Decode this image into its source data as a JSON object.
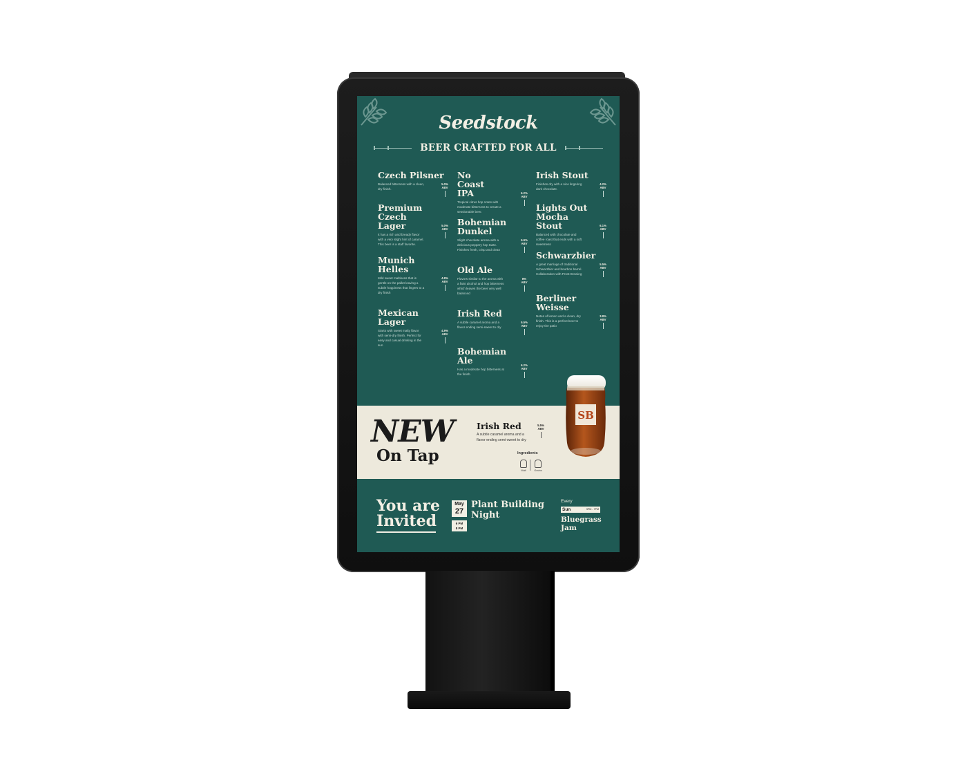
{
  "brand": "Seedstock",
  "tagline": "BEER CRAFTED FOR ALL",
  "colors": {
    "screen_bg": "#1f5a54",
    "band_bg": "#ede9dc",
    "text_light": "#f2efe4"
  },
  "menu": {
    "col1": [
      {
        "name": "Czech Pilsner",
        "desc": "Balanced bitterness with a clean, dry finish.",
        "abv": "5.0%",
        "abv_label": "ABV"
      },
      {
        "name": "Premium Czech Lager",
        "desc": "It has a rich and bready flavor with a very slight hint of caramel. This beer is a staff favorite.",
        "abv": "5.0%",
        "abv_label": "ABV"
      },
      {
        "name": "Munich Helles",
        "desc": "Mild sweet maltiness that is gentle on the pallet leaving a subtle hoppiness that lingers to a dry finish",
        "abv": "4.8%",
        "abv_label": "ABV"
      },
      {
        "name": "Mexican Lager",
        "desc": "Starts with sweet malty flavor with semi-dry finish. Perfect for easy and casual drinking in the sun",
        "abv": "4.9%",
        "abv_label": "ABV"
      }
    ],
    "col2": [
      {
        "name": "No Coast IPA",
        "desc": "Tropical citrus hop notes with moderate bitterness to create a sessionable beer.",
        "abv": "6.2%",
        "abv_label": "ABV"
      },
      {
        "name": "Bohemian Dunkel",
        "desc": "Slight chocolate aroma with a delicious peppery hop taste. Finishes fresh, crisp and clean",
        "abv": "5.9%",
        "abv_label": "ABV"
      },
      {
        "name": "Old Ale",
        "desc": "Flavors similar to the aroma with a faint alcohol and hop bitterness which leaves the beer very well balanced",
        "abv": "8%",
        "abv_label": "ABV"
      },
      {
        "name": "Irish Red",
        "desc": "A subtle caramel aroma and a flavor ending semi-sweet to dry",
        "abv": "5.5%",
        "abv_label": "ABV"
      },
      {
        "name": "Bohemian Ale",
        "desc": "Has a moderate hop bitterness at the finish.",
        "abv": "6.2%",
        "abv_label": "ABV"
      }
    ],
    "col3": [
      {
        "name": "Irish Stout",
        "desc": "Finishes dry with a nice lingering dark chocolate.",
        "abv": "4.2%",
        "abv_label": "ABV"
      },
      {
        "name": "Lights Out Mocha Stout",
        "desc": "Balanced with chocolate and coffee roast that ends with a soft sweetness",
        "abv": "6.1%",
        "abv_label": "ABV"
      },
      {
        "name": "Schwarzbier",
        "desc": "A great marriage of traditional Schwarzbier and bourbon barrel. Collaboration with Prost Brewing",
        "abv": "5.5%",
        "abv_label": "ABV"
      },
      {
        "name": "Berliner Weisse",
        "desc": "Notes of lemon and a clean, dry finish. This is a perfect beer to enjoy the patio",
        "abv": "3.8%",
        "abv_label": "ABV"
      }
    ]
  },
  "new_on_tap": {
    "new_word": "NEW",
    "on_tap": "On Tap",
    "beer_name": "Irish Red",
    "beer_desc": "A subtle caramel aroma and a flavor ending semi-sweet to dry",
    "abv": "5.5%",
    "abv_label": "ABV",
    "ingredients_title": "Ingredients",
    "ingredients": [
      "Malt",
      "Grains"
    ],
    "mug_logo": "SB"
  },
  "footer": {
    "invite": "You are Invited",
    "date_month": "May",
    "date_day": "27",
    "time_start": "6 PM",
    "time_end": "8 PM",
    "event_name": "Plant Building Night",
    "every": "Every",
    "day": "Sun",
    "hours": "5PM - 7PM",
    "recurring_event": "Bluegrass Jam"
  }
}
